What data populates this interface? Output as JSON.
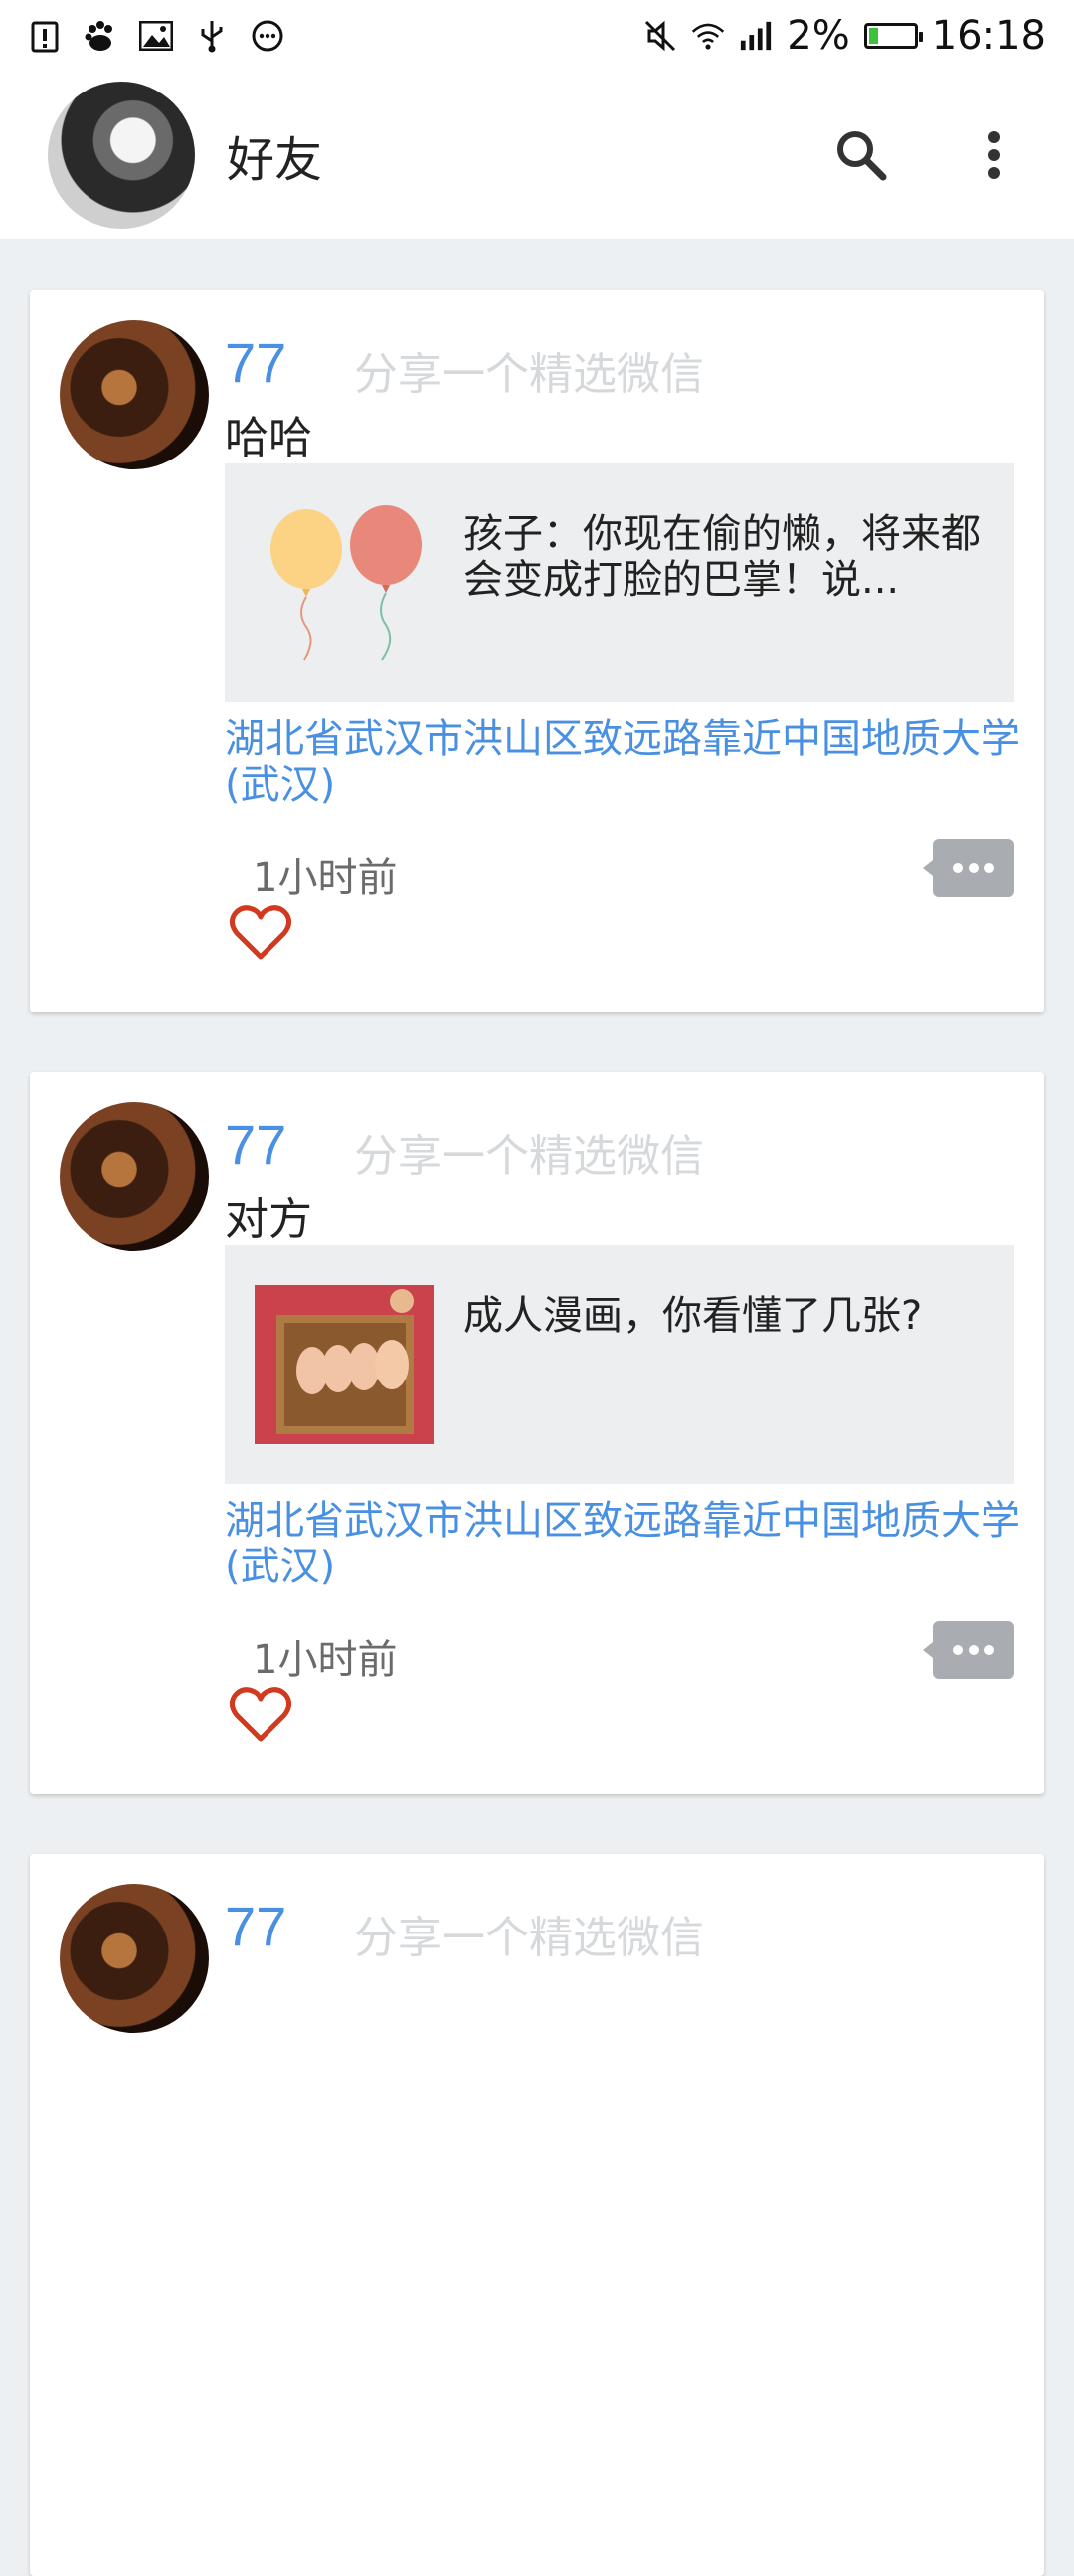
{
  "status_bar": {
    "battery_percent": "2%",
    "time": "16:18",
    "left_icons": [
      "alert-icon",
      "baidu-paw-icon",
      "image-icon",
      "usb-icon",
      "more-circle-icon"
    ],
    "right_icons": [
      "mute-icon",
      "wifi-icon",
      "signal-icon",
      "battery-icon"
    ]
  },
  "app_bar": {
    "title": "好友",
    "actions": [
      "search-icon",
      "more-vert-icon"
    ]
  },
  "posts": [
    {
      "username": "77",
      "share_tag": "分享一个精选微信",
      "text": "哈哈",
      "link_title": "孩子：你现在偷的懒，将来都会变成打脸的巴掌！说...",
      "thumb_icon": "balloons-icon",
      "location": "湖北省武汉市洪山区致远路靠近中国地质大学(武汉)",
      "time": "1小时前"
    },
    {
      "username": "77",
      "share_tag": "分享一个精选微信",
      "text": "对方",
      "link_title": "成人漫画，你看懂了几张?",
      "thumb_icon": "comic-faces-icon",
      "location": "湖北省武汉市洪山区致远路靠近中国地质大学(武汉)",
      "time": "1小时前"
    },
    {
      "username": "77",
      "share_tag": "分享一个精选微信"
    }
  ],
  "colors": {
    "accent_blue": "#4a90e2",
    "like_red": "#d13a1f",
    "background": "#edf0f2"
  }
}
